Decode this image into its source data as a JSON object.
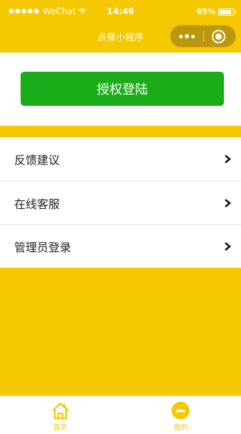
{
  "status_bar": {
    "carrier": "WeChat",
    "time": "14:46",
    "battery": "85%",
    "battery_level": 0.85
  },
  "nav": {
    "title": "点餐小程序"
  },
  "auth": {
    "button_label": "授权登陆"
  },
  "menu": {
    "items": [
      {
        "label": "反馈建议"
      },
      {
        "label": "在线客服"
      },
      {
        "label": "管理员登录"
      }
    ]
  },
  "tabs": [
    {
      "label": "首页",
      "icon": "home-icon"
    },
    {
      "label": "我的",
      "icon": "profile-icon"
    }
  ],
  "colors": {
    "primary": "#f5c800",
    "auth_button": "#1aad19"
  }
}
